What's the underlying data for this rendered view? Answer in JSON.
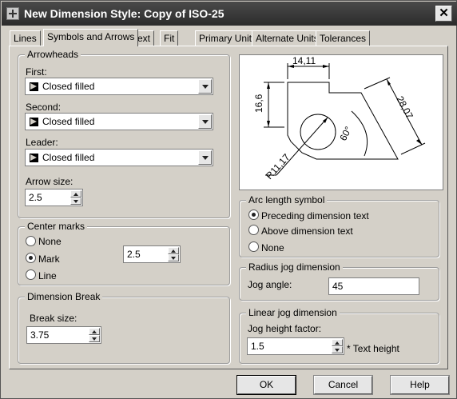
{
  "window": {
    "title": "New Dimension Style: Copy of ISO-25",
    "close_glyph": "✕"
  },
  "tabs": [
    {
      "label": "Lines"
    },
    {
      "label": "Symbols and Arrows"
    },
    {
      "label": "Text"
    },
    {
      "label": "Fit"
    },
    {
      "label": "Primary Units"
    },
    {
      "label": "Alternate Units"
    },
    {
      "label": "Tolerances"
    }
  ],
  "active_tab": "Symbols and Arrows",
  "arrowheads": {
    "legend": "Arrowheads",
    "first_label": "First:",
    "first_value": "Closed filled",
    "second_label": "Second:",
    "second_value": "Closed filled",
    "leader_label": "Leader:",
    "leader_value": "Closed filled",
    "size_label": "Arrow size:",
    "size_value": "2.5"
  },
  "center_marks": {
    "legend": "Center marks",
    "options": [
      "None",
      "Mark",
      "Line"
    ],
    "selected": "Mark",
    "size_value": "2.5"
  },
  "dimension_break": {
    "legend": "Dimension Break",
    "size_label": "Break size:",
    "size_value": "3.75"
  },
  "preview": {
    "dim_top": "14,11",
    "dim_left": "16,6",
    "dim_right": "28,07",
    "angle": "60°",
    "radius": "R11,17"
  },
  "arc_length": {
    "legend": "Arc length symbol",
    "options": [
      "Preceding dimension text",
      "Above dimension text",
      "None"
    ],
    "selected": "Preceding dimension text"
  },
  "radius_jog": {
    "legend": "Radius jog dimension",
    "angle_label": "Jog angle:",
    "angle_value": "45"
  },
  "linear_jog": {
    "legend": "Linear jog dimension",
    "factor_label": "Jog height factor:",
    "factor_value": "1.5",
    "suffix": "* Text height"
  },
  "buttons": {
    "ok": "OK",
    "cancel": "Cancel",
    "help": "Help"
  }
}
